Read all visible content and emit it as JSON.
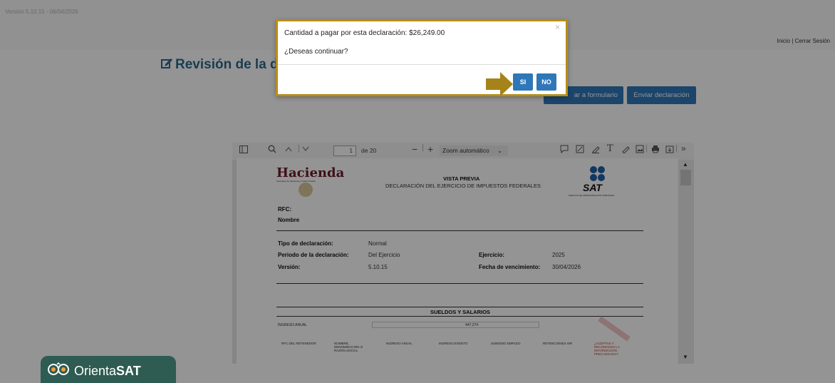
{
  "header": {
    "version": "Versión 5.10.15 - 06/04/2026",
    "inicio": "Inicio",
    "separator": " | ",
    "cerrar_sesion": "Cerrar Sesión"
  },
  "main": {
    "title": "Revisión de la d",
    "regresar_button": "ar a formulario",
    "enviar_button": "Enviar declaración"
  },
  "modal": {
    "message": "Cantidad a pagar por esta declaración: $26,249.00",
    "question": "¿Deseas continuar?",
    "close": "×",
    "yes_label": "SI",
    "no_label": "NO"
  },
  "viewer": {
    "page_number": "1",
    "page_total": "de 20",
    "zoom": "Zoom automático",
    "document": {
      "logo_left": "Hacienda",
      "logo_left_sub": "Secretaría de Hacienda y Crédito Público",
      "logo_right": "SAT",
      "logo_right_sub": "SERVICIO DE ADMINISTRACIÓN TRIBUTARIA",
      "heading": "VISTA PREVIA",
      "subheading": "DECLARACIÓN DEL EJERCICIO DE IMPUESTOS FEDERALES",
      "rfc_label": "RFC:",
      "nombre_label": "Nombre",
      "fields": [
        {
          "label": "Tipo de declaración:",
          "value": "Normal"
        },
        {
          "label": "Periodo de la declaración:",
          "value": "Del Ejercicio"
        },
        {
          "label": "Versión:",
          "value": "5.10.15"
        }
      ],
      "right_fields": [
        {
          "label": "Ejercicio:",
          "value": "2025"
        },
        {
          "label": "Fecha de vencimiento:",
          "value": "30/04/2026"
        }
      ],
      "section_title": "SUELDOS Y SALARIOS",
      "ingreso_anual_label": "INGRESO ANUAL",
      "ingreso_anual_value": "447,274",
      "columns": [
        "RFC DEL RETENEDOR",
        "NOMBRE, DENOMINACIÓN O RAZÓN SOCIAL",
        "INGRESO ANUAL",
        "INGRESO EXENTO",
        "SUBSIDIO EMPLEO",
        "RETENCIONES ISR",
        "¿ACEPTAS Y RECONOCES LA INFORMACIÓN PRECARGADA?"
      ]
    }
  },
  "badge": {
    "orienta": "Orienta",
    "sat": "SAT"
  },
  "colors": {
    "accent_blue": "#2f77b8",
    "modal_border": "#b88d17",
    "badge_green": "#2e5b52"
  }
}
